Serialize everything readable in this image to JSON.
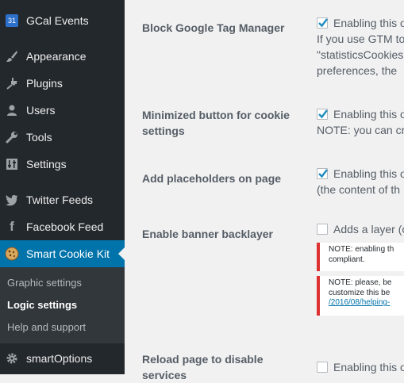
{
  "sidebar": {
    "items": [
      {
        "label": "GCal Events",
        "icon": "calendar-31-icon"
      },
      {
        "label": "Appearance",
        "icon": "paintbrush-icon"
      },
      {
        "label": "Plugins",
        "icon": "plug-icon"
      },
      {
        "label": "Users",
        "icon": "user-icon"
      },
      {
        "label": "Tools",
        "icon": "wrench-icon"
      },
      {
        "label": "Settings",
        "icon": "sliders-icon"
      },
      {
        "label": "Twitter Feeds",
        "icon": "twitter-icon"
      },
      {
        "label": "Facebook Feed",
        "icon": "facebook-icon"
      },
      {
        "label": "Smart Cookie Kit",
        "icon": "cookie-icon"
      },
      {
        "label": "smartOptions",
        "icon": "gear-icon"
      }
    ],
    "calendar_icon_text": "31",
    "submenu": [
      {
        "label": "Graphic settings"
      },
      {
        "label": "Logic settings"
      },
      {
        "label": "Help and support"
      }
    ],
    "colors": {
      "background": "#23282d",
      "active": "#0073aa",
      "submenu": "#32373c"
    }
  },
  "settings": {
    "block_gtm": {
      "label": "Block Google Tag Manager",
      "checked": true,
      "lines": [
        "Enabling this o",
        "If you use GTM to",
        "\"statisticsCookies",
        "preferences, the"
      ]
    },
    "minimized_button": {
      "label_line1": "Minimized button for cookie",
      "label_line2": "settings",
      "checked": true,
      "lines": [
        "Enabling this o",
        "NOTE: you can cr"
      ]
    },
    "placeholders": {
      "label": "Add placeholders on page",
      "checked": true,
      "lines": [
        "Enabling this o",
        "(the content of th"
      ]
    },
    "backlayer": {
      "label": "Enable banner backlayer",
      "checked": false,
      "text": "Adds a layer (c",
      "note1": [
        "NOTE: enabling th",
        "compliant."
      ],
      "note2": [
        "NOTE: please, be",
        "customize this be"
      ],
      "note2_link": "/2016/08/helping-"
    },
    "reload": {
      "label_line1": "Reload page to disable",
      "label_line2": "services",
      "checked": false,
      "text": "Enabling this o"
    }
  }
}
